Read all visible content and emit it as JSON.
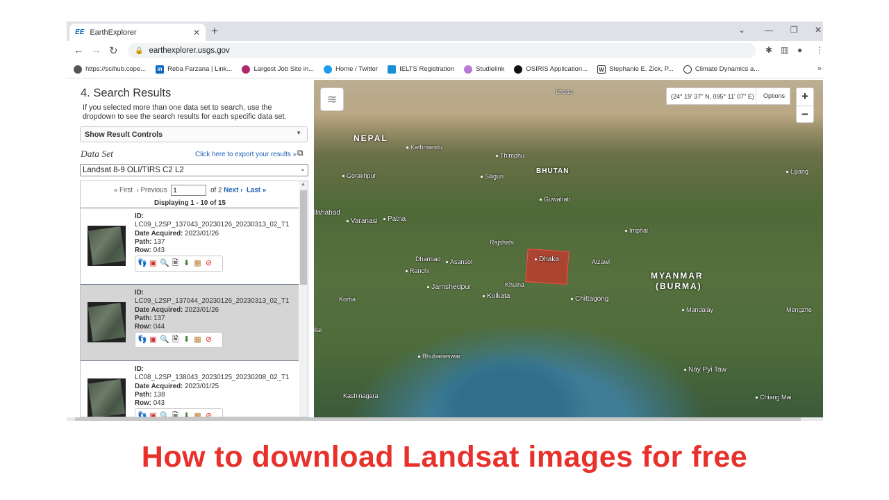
{
  "browser": {
    "tab_title": "EarthExplorer",
    "tab_favicon": "EE",
    "url": "earthexplorer.usgs.gov",
    "bookmarks": [
      {
        "label": "https://scihub.cope...",
        "icon": "globe-icon",
        "color": "#555555"
      },
      {
        "label": "Reba Farzana | Link...",
        "icon": "linkedin-icon",
        "color": "#0a66c2"
      },
      {
        "label": "Largest Job Site in...",
        "icon": "job-site-icon",
        "color": "#b0276e"
      },
      {
        "label": "Home / Twitter",
        "icon": "twitter-icon",
        "color": "#1d9bf0"
      },
      {
        "label": "IELTS Registration",
        "icon": "ielts-icon",
        "color": "#1a8fd6"
      },
      {
        "label": "Studielink",
        "icon": "studielink-icon",
        "color": "#b57ad6"
      },
      {
        "label": "OSIRIS Application...",
        "icon": "osiris-icon",
        "color": "#111111"
      },
      {
        "label": "Stephanie E. Zick, P...",
        "icon": "w-icon",
        "color": "#333333"
      },
      {
        "label": "Climate Dynamics a...",
        "icon": "springer-icon",
        "color": "#333333"
      }
    ],
    "bookmarks_more": "»"
  },
  "panel": {
    "title": "4. Search Results",
    "description": "If you selected more than one data set to search, use the dropdown to see the search results for each specific data set.",
    "result_controls_label": "Show Result Controls",
    "dataset_label": "Data Set",
    "export_link": "Click here to export your results »",
    "dataset_selected": "Landsat 8-9 OLI/TIRS C2 L2",
    "pager": {
      "first": "« First",
      "previous": "‹ Previous",
      "page_value": "1",
      "of_text": "of 2",
      "next": "Next ›",
      "last": "Last »"
    },
    "displaying": "Displaying 1 - 10 of 15",
    "results": [
      {
        "id_label": "ID:",
        "id": "LC09_L2SP_137043_20230126_20230313_02_T1",
        "date_label": "Date Acquired:",
        "date": "2023/01/26",
        "path_label": "Path:",
        "path": "137",
        "row_label": "Row:",
        "row": "043"
      },
      {
        "id_label": "ID:",
        "id": "LC09_L2SP_137044_20230126_20230313_02_T1",
        "date_label": "Date Acquired:",
        "date": "2023/01/26",
        "path_label": "Path:",
        "path": "137",
        "row_label": "Row:",
        "row": "044"
      },
      {
        "id_label": "ID:",
        "id": "LC08_L2SP_138043_20230125_20230208_02_T1",
        "date_label": "Date Acquired:",
        "date": "2023/01/25",
        "path_label": "Path:",
        "path": "138",
        "row_label": "Row:",
        "row": "043"
      }
    ],
    "selected_result_index": 1,
    "result_action_icons": [
      "footprint-icon",
      "browse-overlay-icon",
      "compare-icon",
      "metadata-icon",
      "download-icon",
      "order-icon",
      "exclude-icon"
    ]
  },
  "map": {
    "coordinates": "(24° 19' 37\" N, 095° 11' 07\" E)",
    "options_label": "Options",
    "zoom_in": "+",
    "zoom_out": "−",
    "countries": [
      "NEPAL",
      "BHUTAN",
      "MYANMAR",
      "(BURMA)"
    ],
    "cities": [
      "Lhasa",
      "Kathmandu",
      "Thimphu",
      "Gorakhpur",
      "Siliguri",
      "Guwahati",
      "Lijiang",
      "llahabad",
      "Varanasi",
      "Patna",
      "Imphal",
      "Rajshahi",
      "Dhaka",
      "Dhanbad",
      "Asansol",
      "Aizawl",
      "Ranchi",
      "Jamshedpur",
      "Khulna",
      "Korba",
      "Kolkata",
      "Chittagong",
      "Mandalay",
      "Mengzhe",
      "Bhubaneswar",
      "Nay Pyi Taw",
      "Kashinagara",
      "Chiang Mai",
      "ilai",
      "ilai"
    ],
    "footprint_color": "#e62828"
  },
  "caption": "How to download Landsat images for free"
}
